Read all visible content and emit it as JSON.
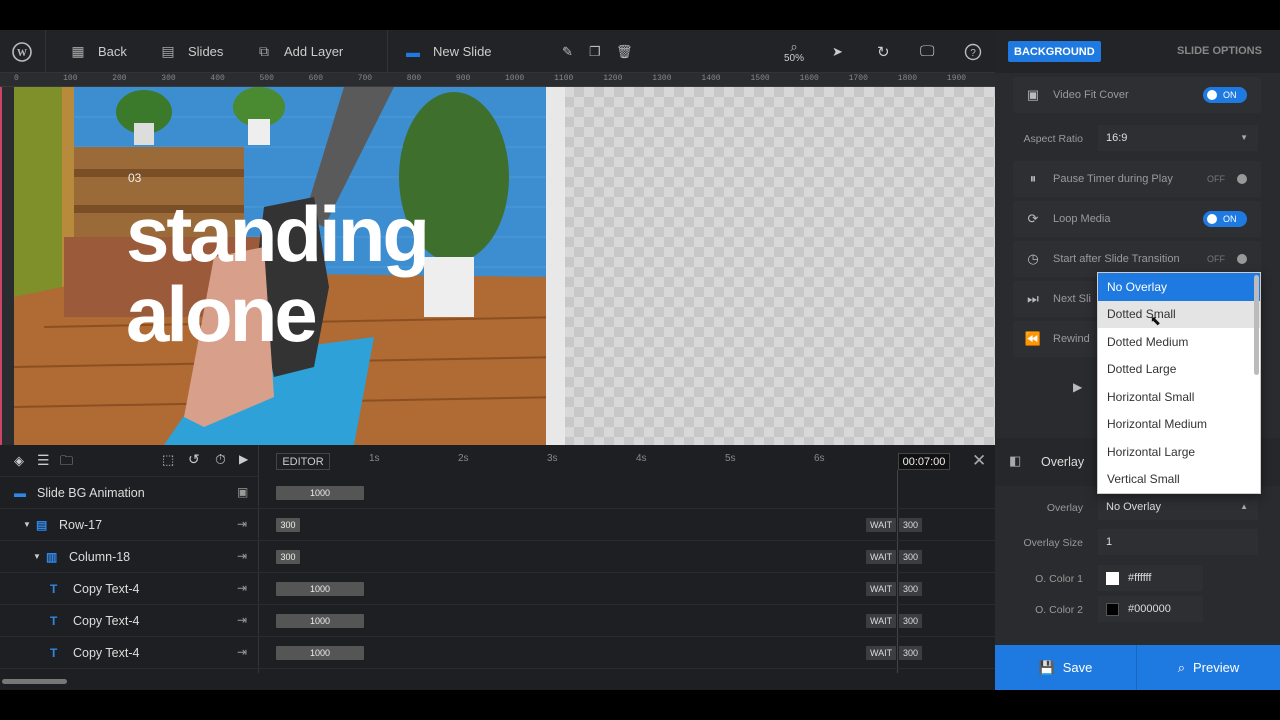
{
  "toolbar": {
    "back_label": "Back",
    "slides_label": "Slides",
    "add_layer_label": "Add Layer",
    "slide_name": "New Slide",
    "zoom": "50%"
  },
  "ruler": {
    "marks": [
      "0",
      "100",
      "200",
      "300",
      "400",
      "500",
      "600",
      "700",
      "800",
      "900",
      "1000",
      "1100",
      "1200",
      "1300",
      "1400",
      "1500",
      "1600",
      "1700",
      "1800",
      "1900",
      "2000"
    ]
  },
  "slide": {
    "number": "03",
    "headline_line1": "standing",
    "headline_line2": "alone"
  },
  "timeline": {
    "editor_label": "EDITOR",
    "time_marks": [
      "1s",
      "2s",
      "3s",
      "4s",
      "5s",
      "6s"
    ],
    "total_time": "00:07:00",
    "rows": [
      {
        "name": "Slide BG Animation",
        "bar": "1000",
        "wait": "",
        "wait_value": ""
      },
      {
        "name": "Row-17",
        "bar": "300",
        "wait": "WAIT",
        "wait_value": "300"
      },
      {
        "name": "Column-18",
        "bar": "300",
        "wait": "WAIT",
        "wait_value": "300"
      },
      {
        "name": "Copy Text-4",
        "bar": "1000",
        "wait": "WAIT",
        "wait_value": "300"
      },
      {
        "name": "Copy Text-4",
        "bar": "1000",
        "wait": "WAIT",
        "wait_value": "300"
      },
      {
        "name": "Copy Text-4",
        "bar": "1000",
        "wait": "WAIT",
        "wait_value": "300"
      }
    ]
  },
  "panel": {
    "tab_background": "BACKGROUND",
    "tab_slide_options": "SLIDE OPTIONS",
    "video_fit_cover": "Video Fit Cover",
    "video_fit_state": "ON",
    "aspect_ratio_label": "Aspect Ratio",
    "aspect_ratio_value": "16:9",
    "pause_timer": "Pause Timer during Play",
    "pause_state": "OFF",
    "loop_media": "Loop Media",
    "loop_state": "ON",
    "start_after": "Start after Slide Transition",
    "start_state": "OFF",
    "next_slide": "Next Sli",
    "rewind": "Rewind",
    "overlay_section": "Overlay",
    "overlay_label": "Overlay",
    "overlay_value": "No Overlay",
    "overlay_size_label": "Overlay Size",
    "overlay_size_value": "1",
    "color1_label": "O. Color 1",
    "color1_value": "#ffffff",
    "color2_label": "O. Color 2",
    "color2_value": "#000000"
  },
  "dropdown": {
    "options": [
      "No Overlay",
      "Dotted Small",
      "Dotted Medium",
      "Dotted Large",
      "Horizontal Small",
      "Horizontal Medium",
      "Horizontal Large",
      "Vertical Small"
    ],
    "selected": "No Overlay",
    "hovered": "Dotted Small"
  },
  "footer": {
    "save_label": "Save",
    "preview_label": "Preview"
  },
  "colors": {
    "accent": "#1e7ae0",
    "panel_bg": "#2a2b2e",
    "toolbar_bg": "#222326"
  }
}
